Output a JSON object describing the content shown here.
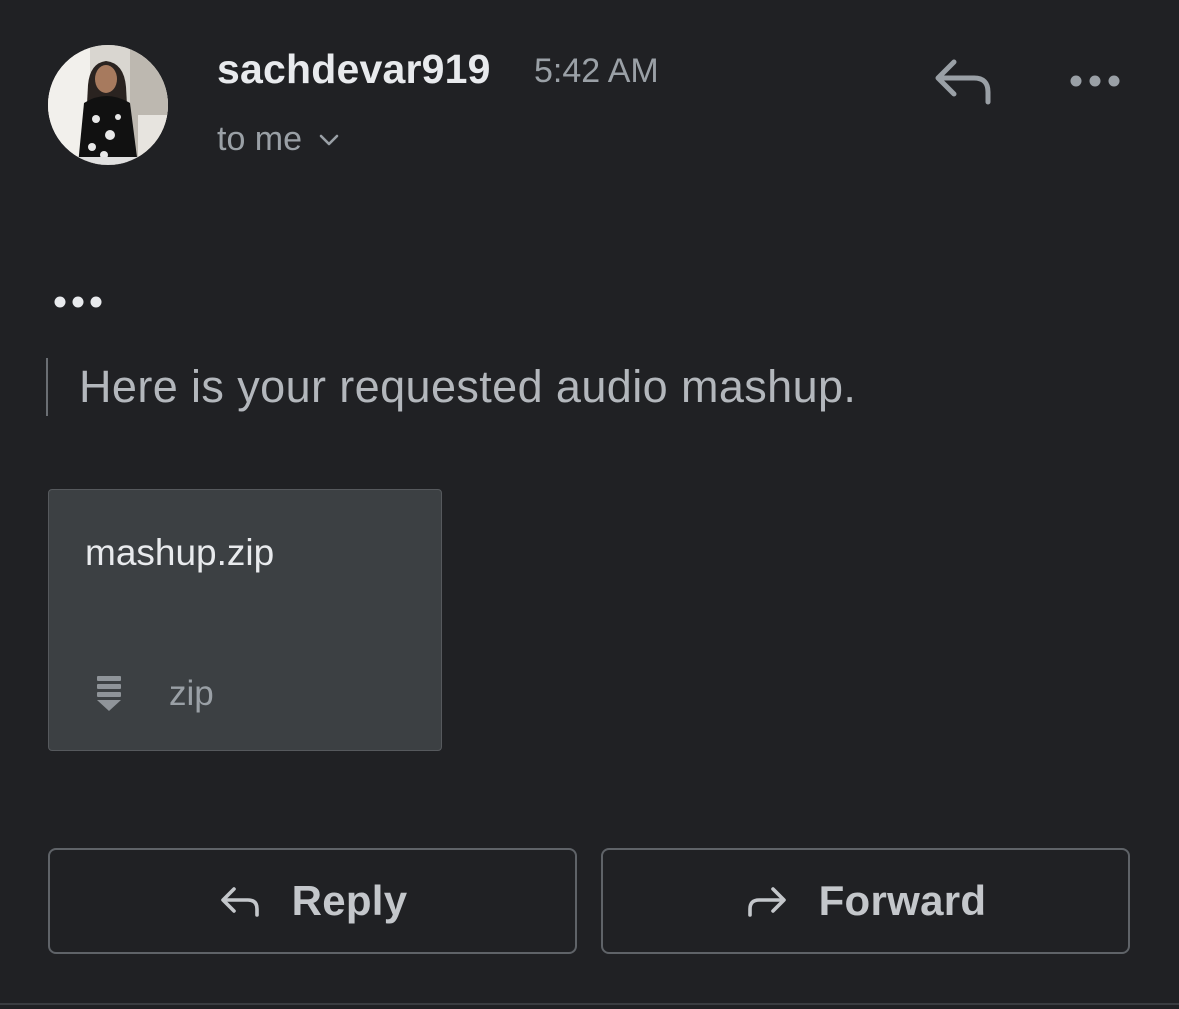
{
  "message": {
    "sender_name": "sachdevar919",
    "time": "5:42 AM",
    "recipient_label": "to me",
    "body_text": "Here is your requested audio mashup."
  },
  "icons": {
    "avatar": "sender-avatar-photo",
    "reply_top": "reply-icon",
    "more_top": "more-horizontal-icon",
    "expand_recipients": "chevron-down-icon",
    "trimmed_content": "more-horizontal-icon",
    "attachment_type": "zip-file-icon",
    "reply_button": "reply-icon",
    "forward_button": "forward-icon"
  },
  "attachment": {
    "filename": "mashup.zip",
    "type_label": "zip"
  },
  "actions": {
    "reply_label": "Reply",
    "forward_label": "Forward"
  },
  "colors": {
    "background": "#202124",
    "primary_text": "#e8eaed",
    "secondary_text": "#9aa0a6",
    "attachment_bg": "#3c4043",
    "button_border": "#5f6368"
  }
}
